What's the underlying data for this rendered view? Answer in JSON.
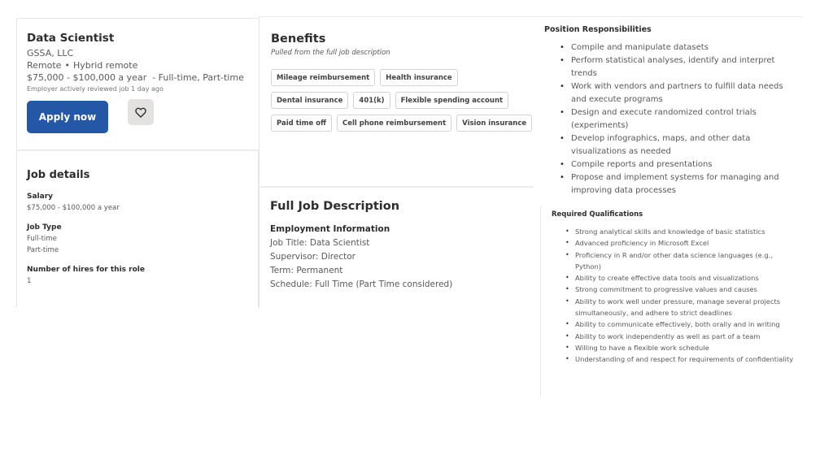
{
  "header": {
    "job_title": "Data Scientist",
    "company": "GSSA, LLC",
    "location": "Remote",
    "location_separator": "•",
    "work_mode": "Hybrid remote",
    "salary_line": "$75,000 - $100,000 a year  - Full-time, Part-time",
    "reviewed_note": "Employer actively reviewed job 1 day ago",
    "apply_label": "Apply now",
    "save_icon": "heart-icon"
  },
  "job_details": {
    "title": "Job details",
    "salary_label": "Salary",
    "salary_value": "$75,000 - $100,000 a year",
    "job_type_label": "Job Type",
    "job_types": [
      "Full-time",
      "Part-time"
    ],
    "hires_label": "Number of hires for this role",
    "hires_value": "1"
  },
  "benefits": {
    "title": "Benefits",
    "subtitle": "Pulled from the full job description",
    "items": [
      "Mileage reimbursement",
      "Health insurance",
      "Dental insurance",
      "401(k)",
      "Flexible spending account",
      "Paid time off",
      "Cell phone reimbursement",
      "Vision insurance"
    ]
  },
  "description": {
    "title": "Full Job Description",
    "employment_label": "Employment Information",
    "lines": [
      "Job Title: Data Scientist",
      "Supervisor: Director",
      "Term: Permanent",
      "Schedule: Full Time (Part Time considered)"
    ]
  },
  "responsibilities": {
    "title": "Position Responsibilities",
    "items": [
      "Compile and manipulate datasets",
      "Perform statistical analyses, identify and interpret trends",
      "Work with vendors and partners to fulfill data needs and execute programs",
      "Design and execute randomized control trials (experiments)",
      "Develop infographics, maps, and other data visualizations as needed",
      "Compile reports and presentations",
      "Propose and implement systems for managing and improving data processes"
    ]
  },
  "qualifications": {
    "title": "Required Qualifications",
    "items": [
      "Strong analytical skills and knowledge of basic statistics",
      "Advanced proficiency in Microsoft Excel",
      "Proficiency in R and/or other data science languages (e.g., Python)",
      "Ability to create effective data tools and visualizations",
      "Strong commitment to progressive values and causes",
      "Ability to work well under pressure, manage several projects simultaneously, and adhere to strict deadlines",
      "Ability to communicate effectively, both orally and in writing",
      "Ability to work independently as well as part of a team",
      "Willing to have a flexible work schedule",
      "Understanding of and respect for requirements of confidentiality"
    ]
  }
}
